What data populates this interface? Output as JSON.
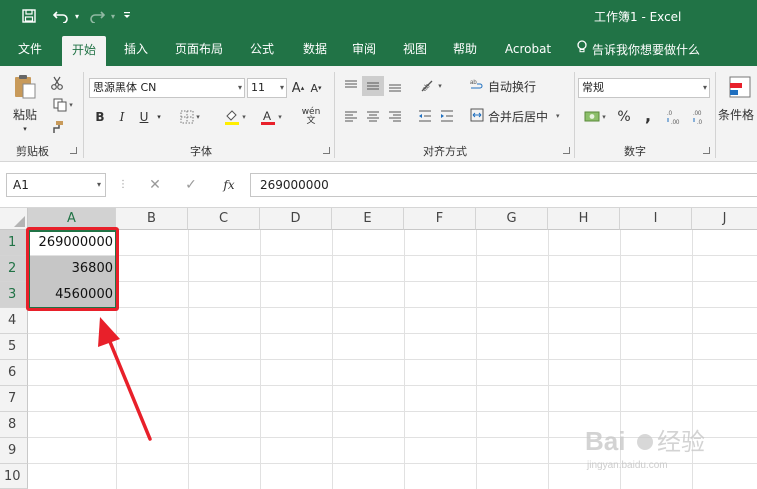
{
  "title_bar": {
    "save_icon": "save-icon",
    "undo_icon": "undo-icon",
    "redo_icon": "redo-icon",
    "customize_icon": "customize-quick-access-icon",
    "title": "工作簿1  -  Excel"
  },
  "tabs": [
    {
      "label": "文件"
    },
    {
      "label": "开始"
    },
    {
      "label": "插入"
    },
    {
      "label": "页面布局"
    },
    {
      "label": "公式"
    },
    {
      "label": "数据"
    },
    {
      "label": "审阅"
    },
    {
      "label": "视图"
    },
    {
      "label": "帮助"
    },
    {
      "label": "Acrobat"
    },
    {
      "label": "告诉我你想要做什么"
    }
  ],
  "ribbon": {
    "clipboard": {
      "paste": "粘贴",
      "group": "剪贴板"
    },
    "font": {
      "family": "思源黑体 CN",
      "size": "11",
      "bold": "B",
      "italic": "I",
      "underline": "U",
      "grow": "A",
      "shrink": "A",
      "phonetic": "wén",
      "group": "字体"
    },
    "alignment": {
      "wrap_text": "自动换行",
      "merge_center": "合并后居中",
      "group": "对齐方式"
    },
    "number": {
      "format": "常规",
      "percent": "%",
      "comma": ",",
      "group": "数字"
    },
    "styles": {
      "conditional": "条件格"
    }
  },
  "formula_bar": {
    "name_box": "A1",
    "cancel": "✕",
    "enter": "✓",
    "fx": "fx",
    "value": "269000000"
  },
  "grid": {
    "columns": [
      "A",
      "B",
      "C",
      "D",
      "E",
      "F",
      "G",
      "H",
      "I",
      "J"
    ],
    "rows": [
      "1",
      "2",
      "3",
      "4",
      "5",
      "6",
      "7",
      "8",
      "9",
      "10"
    ],
    "cells": {
      "A1": "269000000",
      "A2": "36800",
      "A3": "4560000"
    }
  },
  "colors": {
    "excel_green": "#217346",
    "selection_fill": "#c6c6c6",
    "annotation_red": "#e8202a"
  },
  "watermark": {
    "text": "Baidu经验",
    "sub": "jingyan.baidu.com"
  }
}
